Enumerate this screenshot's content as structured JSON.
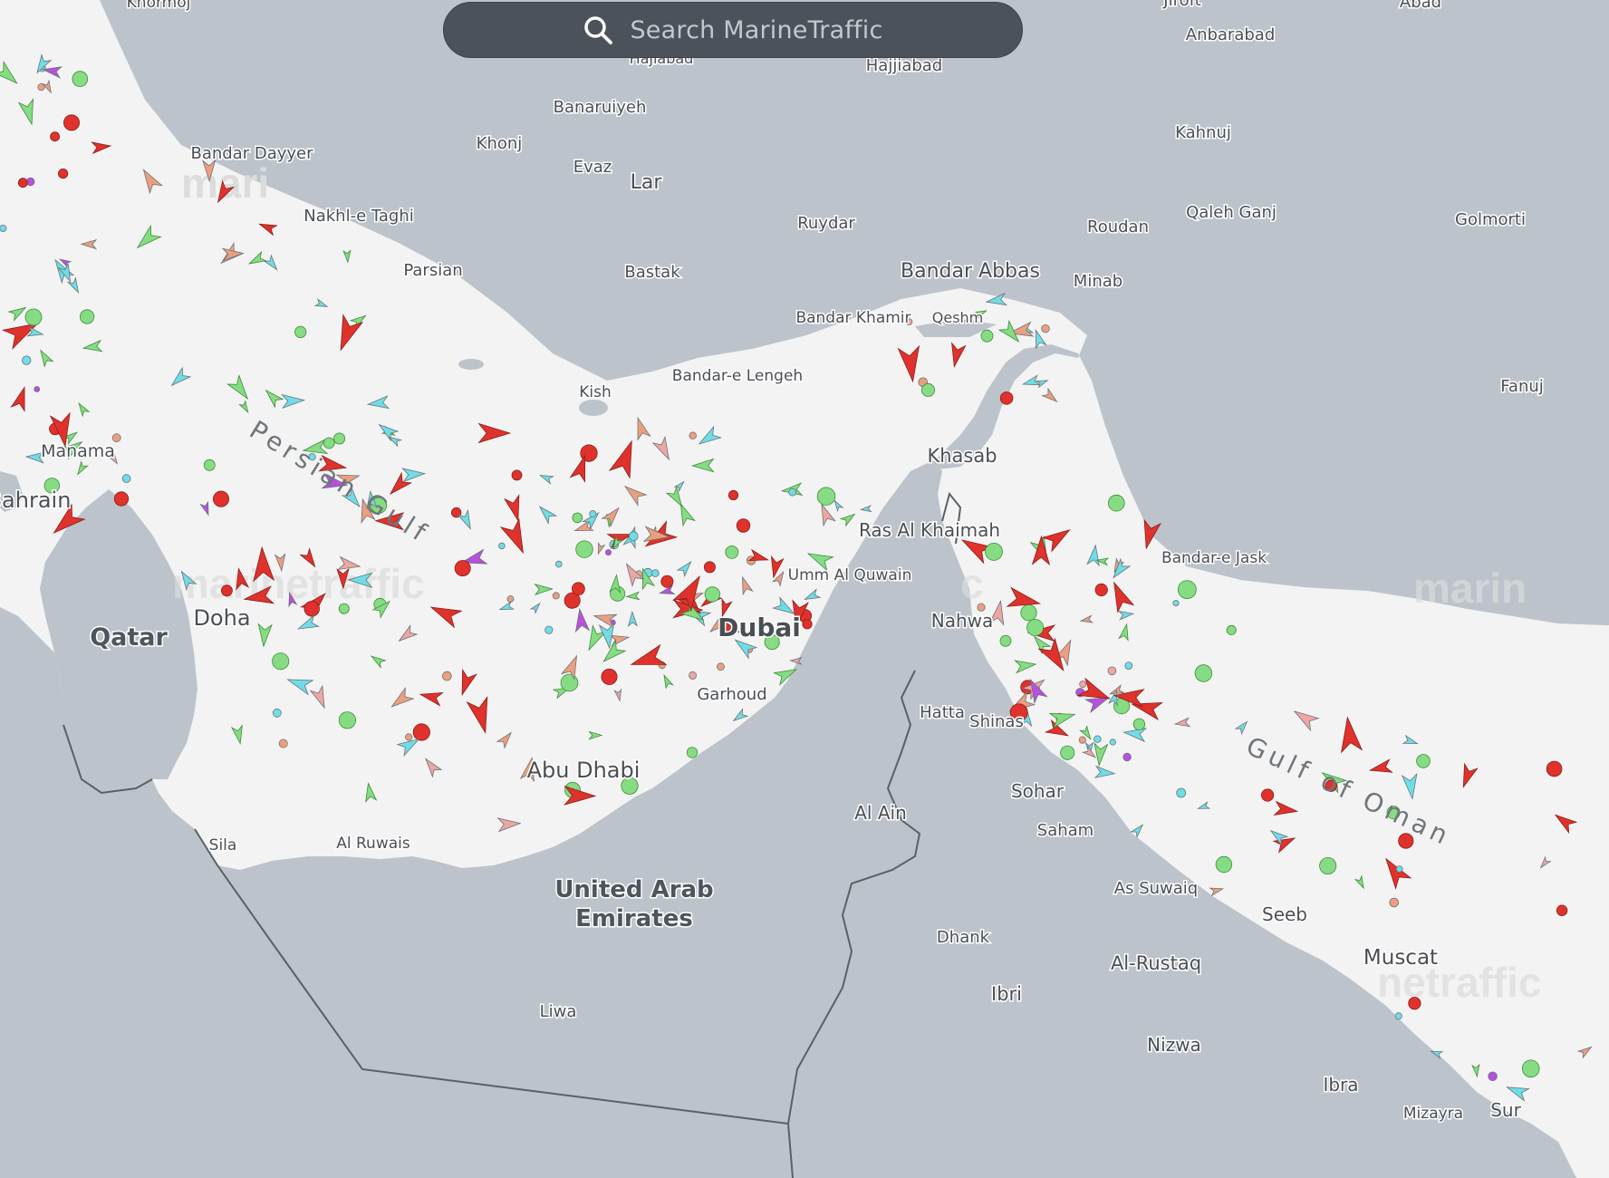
{
  "search": {
    "placeholder": "Search MarineTraffic"
  },
  "map": {
    "watermark": "marinetraffic",
    "colors": {
      "water": "#f3f3f3",
      "land": "#bcc3ca",
      "border": "#5b6066",
      "label": "#4a4f55",
      "cargo": "#86dc82",
      "tanker": "#e0322c",
      "passenger": "#6fdde8",
      "highspeed": "#b84fe0",
      "special": "#ec9f7e",
      "other": "#eea6a3"
    },
    "countries": [
      "Qatar",
      "United Arab Emirates"
    ],
    "seas": [
      "Persian Gulf",
      "Gulf of Oman"
    ],
    "cities": [
      "Khormoj",
      "Jiroft",
      "Abad",
      "Anbarabad",
      "Hajiabad",
      "Hajjiabad",
      "Banaruiyeh",
      "Kahnuj",
      "Bandar Dayyer",
      "Khonj",
      "Evaz",
      "Lar",
      "Nakhl-e Taghi",
      "Ruydar",
      "Roudan",
      "Qaleh Ganj",
      "Golmorti",
      "Parsian",
      "Bastak",
      "Bandar Abbas",
      "Minab",
      "Bandar Khamir",
      "Qeshm",
      "Bandar-e Lengeh",
      "Kish",
      "Fanuj",
      "Manama",
      "Bahrain",
      "Khasab",
      "Ras Al Khaimah",
      "Bandar-e Jask",
      "Umm Al Quwain",
      "Doha",
      "Dubai",
      "Nahwa",
      "Garhoud",
      "Hatta",
      "Shinas",
      "Abu Dhabi",
      "Sohar",
      "Al Ain",
      "Saham",
      "Sila",
      "Al Ruwais",
      "As Suwaiq",
      "Seeb",
      "Muscat",
      "Dhank",
      "Al-Rustaq",
      "Ibri",
      "Liwa",
      "Nizwa",
      "Ibra",
      "Mizayra",
      "Sur"
    ]
  }
}
